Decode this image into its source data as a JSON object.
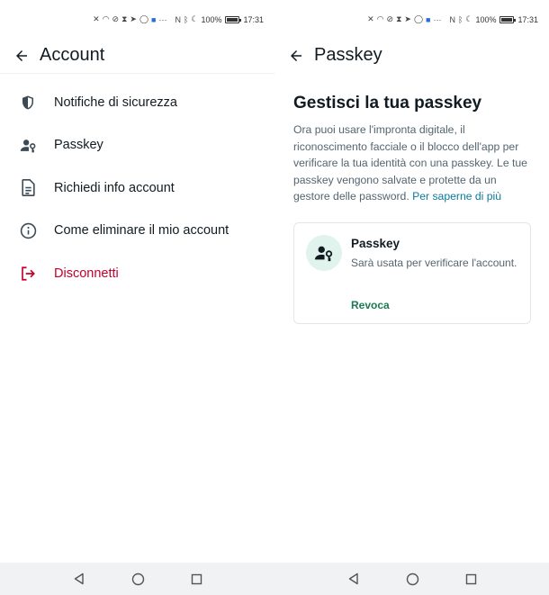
{
  "status": {
    "battery": "100%",
    "time": "17:31",
    "icons": [
      "mute-icon",
      "wifi-icon",
      "signal-off-icon",
      "hourglass-icon",
      "telegram-icon",
      "whatsapp-icon",
      "app-icon",
      "more-dots-icon",
      "nfc-icon",
      "bluetooth-icon",
      "moon-icon",
      "battery-icon"
    ]
  },
  "account_screen": {
    "title": "Account",
    "items": [
      {
        "label": "Notifiche di sicurezza",
        "icon": "shield-icon"
      },
      {
        "label": "Passkey",
        "icon": "person-key-icon"
      },
      {
        "label": "Richiedi info account",
        "icon": "document-icon"
      },
      {
        "label": "Come eliminare il mio account",
        "icon": "info-icon"
      },
      {
        "label": "Disconnetti",
        "icon": "logout-icon"
      }
    ],
    "danger_color": "#c1002c"
  },
  "passkey_screen": {
    "title": "Passkey",
    "heading": "Gestisci la tua passkey",
    "description": "Ora puoi usare l'impronta digitale, il riconoscimento facciale o il blocco dell'app per verificare la tua identità con una passkey. Le tue passkey vengono salvate e protette da un gestore delle password.",
    "learn_more": "Per saperne di più",
    "card": {
      "title": "Passkey",
      "description": "Sarà usata per verificare l'account.",
      "action": "Revoca"
    },
    "accent_color": "#1a7a55",
    "link_color": "#0b7a9b"
  },
  "navigation": [
    "back-triangle-icon",
    "home-circle-icon",
    "recents-square-icon"
  ]
}
